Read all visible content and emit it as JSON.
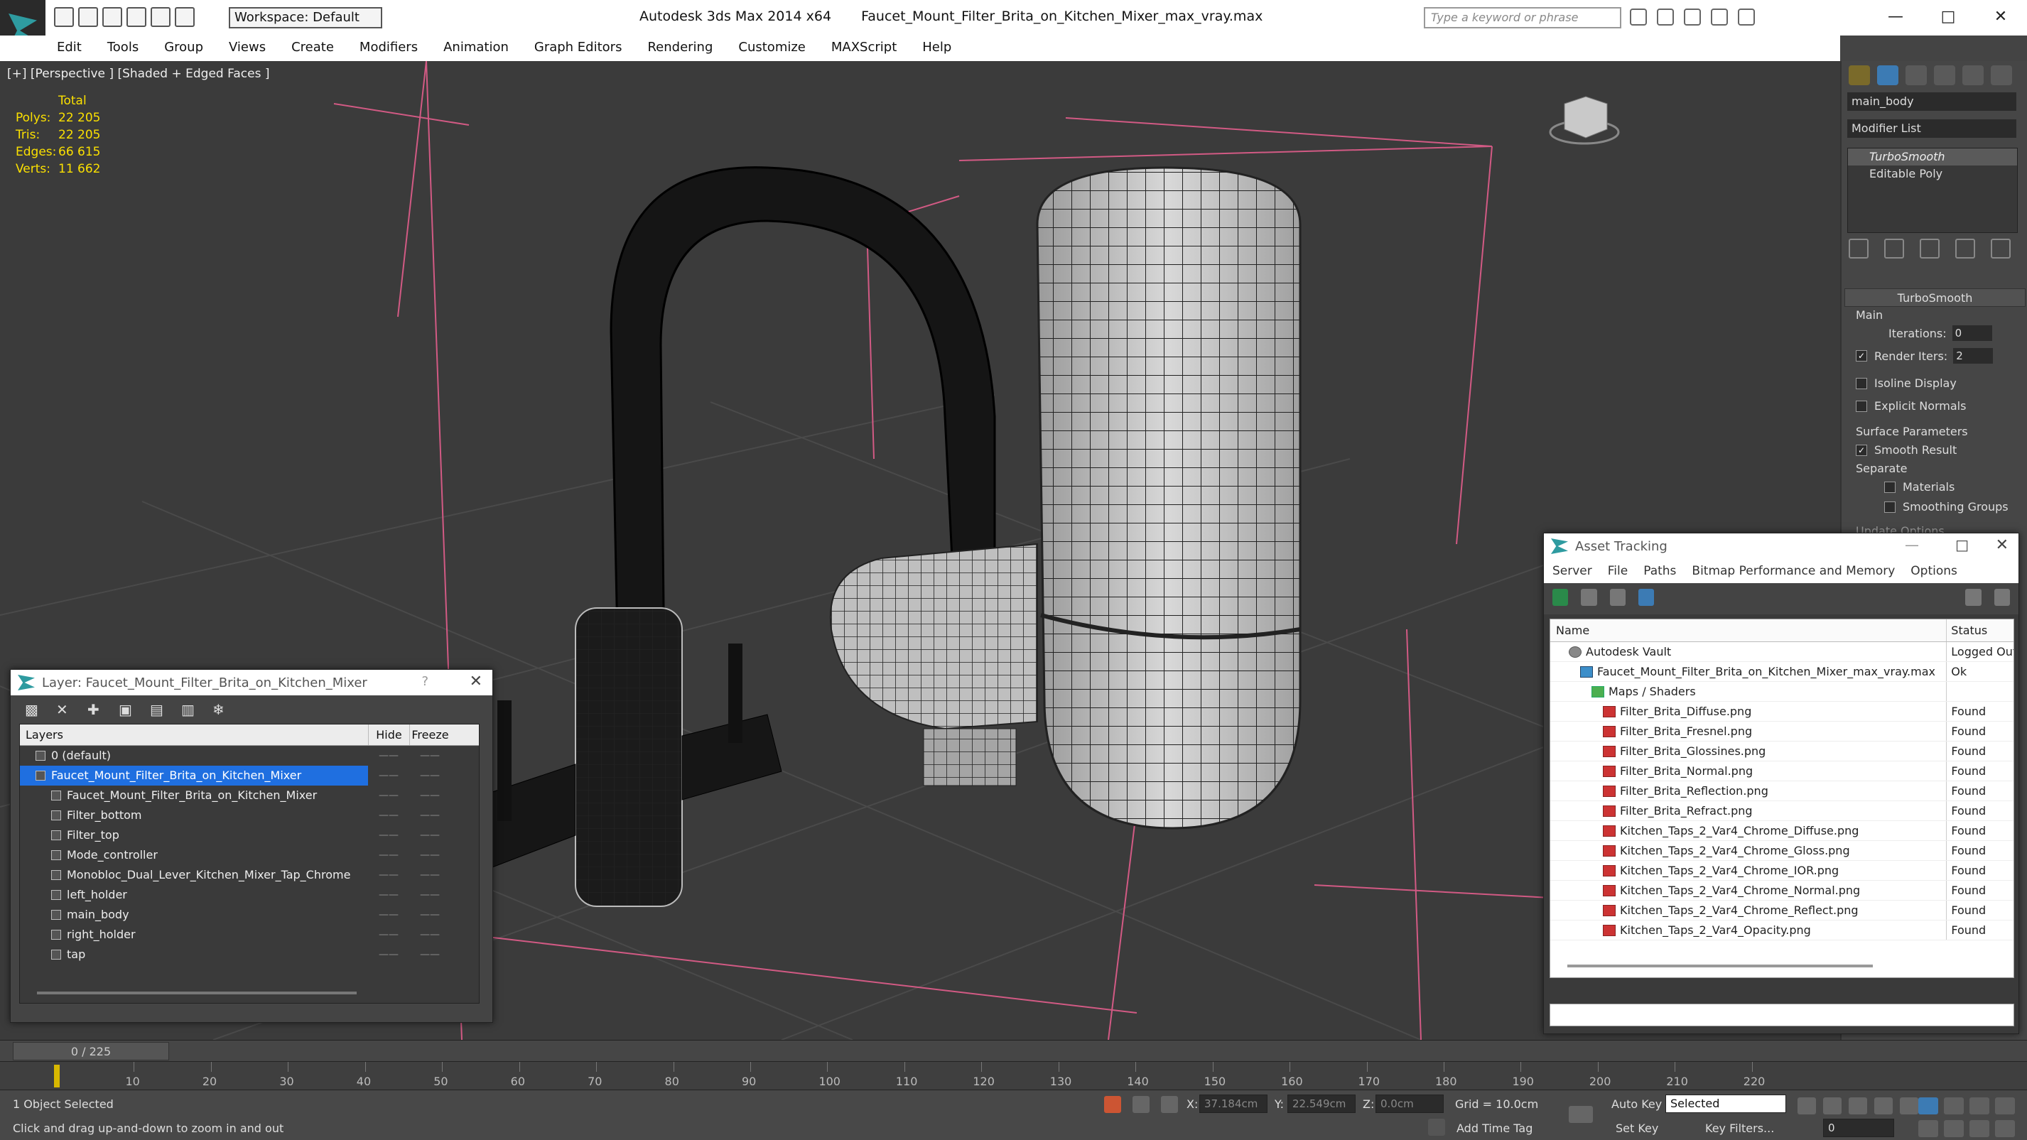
{
  "app": {
    "workspace": "Workspace: Default",
    "title": "Autodesk 3ds Max  2014 x64",
    "file": "Faucet_Mount_Filter_Brita_on_Kitchen_Mixer_max_vray.max",
    "search_placeholder": "Type a keyword or phrase"
  },
  "menu": [
    "Edit",
    "Tools",
    "Group",
    "Views",
    "Create",
    "Modifiers",
    "Animation",
    "Graph Editors",
    "Rendering",
    "Customize",
    "MAXScript",
    "Help"
  ],
  "viewport": {
    "label": "[+] [Perspective ] [Shaded + Edged Faces ]",
    "stats_header": "Total",
    "stats": [
      {
        "k": "Polys:",
        "v": "22 205"
      },
      {
        "k": "Tris:",
        "v": "22 205"
      },
      {
        "k": "Edges:",
        "v": "66 615"
      },
      {
        "k": "Verts:",
        "v": "11 662"
      }
    ]
  },
  "command_panel": {
    "object_name": "main_body",
    "modifier_list": "Modifier List",
    "stack": [
      "TurboSmooth",
      "Editable Poly"
    ],
    "rollout_title": "TurboSmooth",
    "main_label": "Main",
    "iterations_label": "Iterations:",
    "iterations_value": "0",
    "render_iters_label": "Render Iters:",
    "render_iters_value": "2",
    "isoline": "Isoline Display",
    "explicit_normals": "Explicit Normals",
    "surface_params": "Surface Parameters",
    "smooth_result": "Smooth Result",
    "separate": "Separate",
    "materials": "Materials",
    "smoothing_groups": "Smoothing Groups",
    "update_options": "Update Options"
  },
  "layer_dialog": {
    "title": "Layer: Faucet_Mount_Filter_Brita_on_Kitchen_Mixer",
    "help": "?",
    "col_layers": "Layers",
    "col_hide": "Hide",
    "col_freeze": "Freeze",
    "rows": [
      {
        "name": "0 (default)",
        "indent": 1
      },
      {
        "name": "Faucet_Mount_Filter_Brita_on_Kitchen_Mixer",
        "indent": 1
      },
      {
        "name": "Faucet_Mount_Filter_Brita_on_Kitchen_Mixer",
        "indent": 2
      },
      {
        "name": "Filter_bottom",
        "indent": 2
      },
      {
        "name": "Filter_top",
        "indent": 2
      },
      {
        "name": "Mode_controller",
        "indent": 2
      },
      {
        "name": "Monobloc_Dual_Lever_Kitchen_Mixer_Tap_Chrome",
        "indent": 2
      },
      {
        "name": "left_holder",
        "indent": 2
      },
      {
        "name": "main_body",
        "indent": 2
      },
      {
        "name": "right_holder",
        "indent": 2
      },
      {
        "name": "tap",
        "indent": 2
      }
    ]
  },
  "asset_tracking": {
    "title": "Asset Tracking",
    "menu": [
      "Server",
      "File",
      "Paths",
      "Bitmap Performance and Memory",
      "Options"
    ],
    "col_name": "Name",
    "col_status": "Status",
    "rows": [
      {
        "name": "Autodesk Vault",
        "status": "Logged Out",
        "type": "vault",
        "indent": 1
      },
      {
        "name": "Faucet_Mount_Filter_Brita_on_Kitchen_Mixer_max_vray.max",
        "status": "Ok",
        "type": "max",
        "indent": 2
      },
      {
        "name": "Maps / Shaders",
        "status": "",
        "type": "dir",
        "indent": 3
      },
      {
        "name": "Filter_Brita_Diffuse.png",
        "status": "Found",
        "type": "png",
        "indent": 4
      },
      {
        "name": "Filter_Brita_Fresnel.png",
        "status": "Found",
        "type": "png",
        "indent": 4
      },
      {
        "name": "Filter_Brita_Glossines.png",
        "status": "Found",
        "type": "png",
        "indent": 4
      },
      {
        "name": "Filter_Brita_Normal.png",
        "status": "Found",
        "type": "png",
        "indent": 4
      },
      {
        "name": "Filter_Brita_Reflection.png",
        "status": "Found",
        "type": "png",
        "indent": 4
      },
      {
        "name": "Filter_Brita_Refract.png",
        "status": "Found",
        "type": "png",
        "indent": 4
      },
      {
        "name": "Kitchen_Taps_2_Var4_Chrome_Diffuse.png",
        "status": "Found",
        "type": "png",
        "indent": 4
      },
      {
        "name": "Kitchen_Taps_2_Var4_Chrome_Gloss.png",
        "status": "Found",
        "type": "png",
        "indent": 4
      },
      {
        "name": "Kitchen_Taps_2_Var4_Chrome_IOR.png",
        "status": "Found",
        "type": "png",
        "indent": 4
      },
      {
        "name": "Kitchen_Taps_2_Var4_Chrome_Normal.png",
        "status": "Found",
        "type": "png",
        "indent": 4
      },
      {
        "name": "Kitchen_Taps_2_Var4_Chrome_Reflect.png",
        "status": "Found",
        "type": "png",
        "indent": 4
      },
      {
        "name": "Kitchen_Taps_2_Var4_Opacity.png",
        "status": "Found",
        "type": "png",
        "indent": 4
      }
    ]
  },
  "timeline": {
    "frame": "0 / 225",
    "ticks": [
      "10",
      "20",
      "30",
      "40",
      "50",
      "60",
      "70",
      "80",
      "90",
      "100",
      "110",
      "120",
      "130",
      "140",
      "150",
      "160",
      "170",
      "180",
      "190",
      "200",
      "210",
      "220"
    ]
  },
  "status": {
    "selected": "1 Object Selected",
    "hint": "Click and drag up-and-down to zoom in and out",
    "x_label": "X:",
    "x_value": "37.184cm",
    "y_label": "Y:",
    "y_value": "22.549cm",
    "z_label": "Z:",
    "z_value": "0.0cm",
    "grid": "Grid = 10.0cm",
    "add_time_tag": "Add Time Tag",
    "auto_key": "Auto Key",
    "set_key": "Set Key",
    "selected_mode": "Selected",
    "key_filters": "Key Filters...",
    "frame_value": "0"
  }
}
